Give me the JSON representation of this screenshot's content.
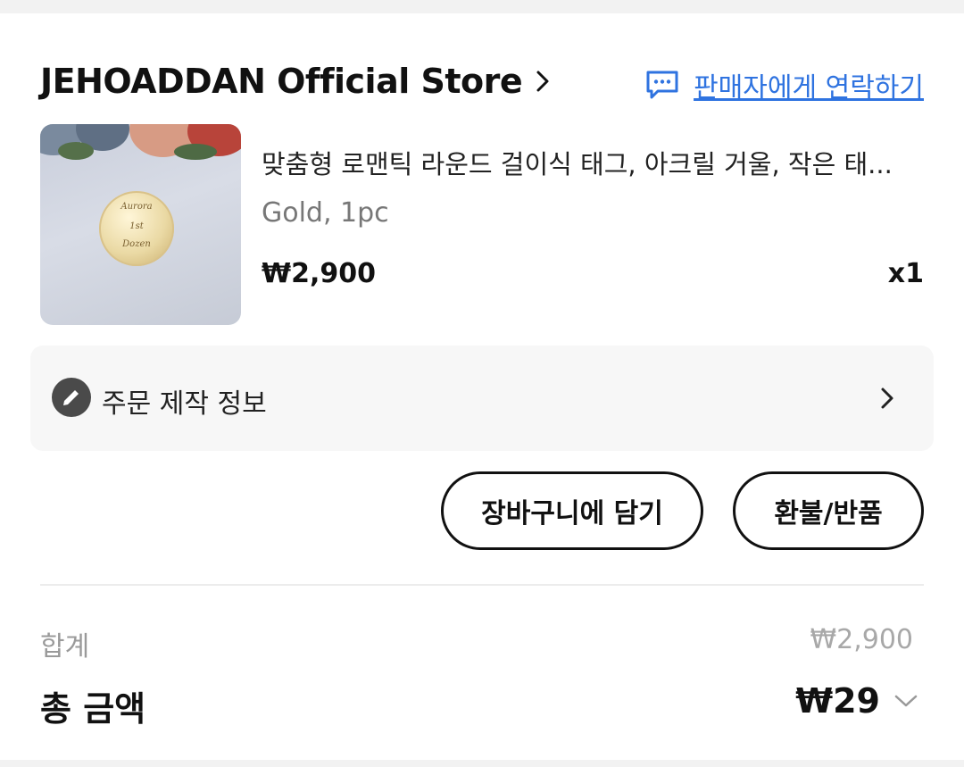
{
  "store": {
    "name": "JEHOADDAN Official Store",
    "contact_label": "판매자에게 연락하기"
  },
  "product": {
    "title": "맞춤형 로맨틱 라운드 걸이식 태그, 아크릴 거울, 작은 태...",
    "variant": "Gold, 1pc",
    "price": "₩2,900",
    "quantity": "x1",
    "image_text": [
      "Aurora",
      "1st",
      "Dozen"
    ]
  },
  "customization": {
    "label": "주문 제작 정보"
  },
  "actions": {
    "add_to_cart": "장바구니에 담기",
    "refund_return": "환불/반품"
  },
  "summary": {
    "subtotal_label": "합계",
    "subtotal_value": "₩2,900",
    "total_label": "총 금액",
    "total_value": "₩29"
  },
  "colors": {
    "link_blue": "#2f73e0",
    "muted_gray": "#9a9a9a",
    "panel_gray": "#f7f7f7"
  },
  "icons": {
    "store_chevron": "chevron-right-icon",
    "contact": "chat-bubble-icon",
    "customization": "pencil-icon",
    "customization_chevron": "chevron-right-icon",
    "total_toggle": "chevron-down-icon"
  }
}
